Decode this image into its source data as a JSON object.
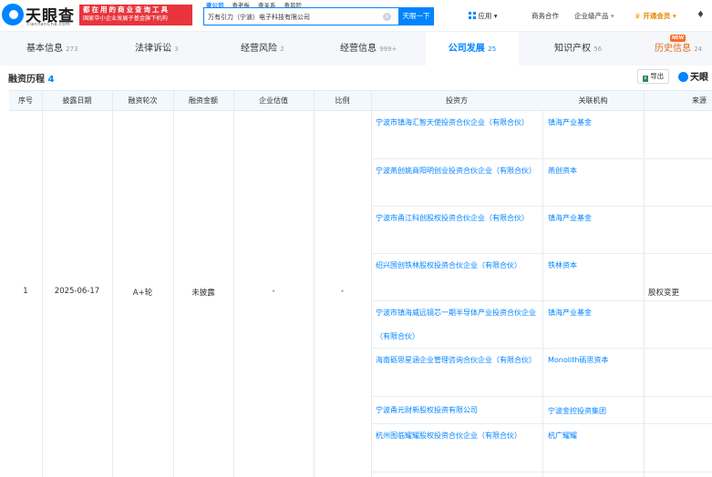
{
  "brand": {
    "name_cn": "天眼查",
    "name_en": "TianYanCha.com"
  },
  "promo": {
    "line1": "都在用的商业查询工具",
    "line2": "国家中小企业发展子基金旗下机构"
  },
  "search": {
    "tabs": [
      "查公司",
      "查老板",
      "查关系",
      "查风险"
    ],
    "query": "万有引力（宁波）电子科技有限公司",
    "button": "天眼一下"
  },
  "nav": {
    "apps": "应用",
    "business": "商务合作",
    "enterprise": "企业级产品",
    "vip": "开通会员"
  },
  "tabs": [
    {
      "label": "基本信息",
      "count": "273"
    },
    {
      "label": "法律诉讼",
      "count": "3"
    },
    {
      "label": "经营风险",
      "count": "2"
    },
    {
      "label": "经营信息",
      "count": "999+"
    },
    {
      "label": "公司发展",
      "count": "25"
    },
    {
      "label": "知识产权",
      "count": "56"
    },
    {
      "label": "历史信息",
      "count": "24"
    }
  ],
  "new_badge": "NEW",
  "section": {
    "title": "融资历程",
    "count": "4",
    "export": "导出",
    "brand_mini": "天眼"
  },
  "table": {
    "headers": [
      "序号",
      "披露日期",
      "融资轮次",
      "融资金额",
      "企业估值",
      "比例",
      "投资方",
      "关联机构",
      "来源"
    ],
    "row": {
      "index": "1",
      "date": "2025-06-17",
      "round": "A+轮",
      "amount": "未披露",
      "valuation": "-",
      "ratio": "-",
      "source": "股权变更",
      "investors": [
        {
          "name": "宁波市镇海汇智天使投资合伙企业（有限合伙）",
          "institution": "镇海产业基金"
        },
        {
          "name": "宁波燕创姚商阳明创业投资合伙企业（有限合伙）",
          "institution": "燕创资本"
        },
        {
          "name": "宁波市甬江科创股权投资合伙企业（有限合伙）",
          "institution": "镇海产业基金"
        },
        {
          "name": "绍兴国创铁林股权投资合伙企业（有限合伙）",
          "institution": "铁林资本"
        },
        {
          "name": "宁波市镇海威远镜芯一期半导体产业投资合伙企业（有限合伙）",
          "institution": "镇海产业基金"
        },
        {
          "name": "海南砺思星涵企业管理咨询合伙企业（有限合伙）",
          "institution": "Monolith砺思资本"
        },
        {
          "name": "宁波甬元财新股权投资有限公司",
          "institution": "宁波金控投资集团"
        },
        {
          "name": "杭州图临耀耀股权投资合伙企业（有限合伙）",
          "institution": "杭广耀耀"
        }
      ]
    }
  },
  "colors": {
    "accent": "#0084ff",
    "promo_red": "#e8353d",
    "history": "#e46a17",
    "vip": "#e88a00"
  },
  "icons": [
    "search-clear-icon",
    "apps-grid-icon",
    "chevron-down-icon",
    "crown-icon",
    "bell-icon",
    "excel-icon",
    "brand-logo-icon"
  ]
}
